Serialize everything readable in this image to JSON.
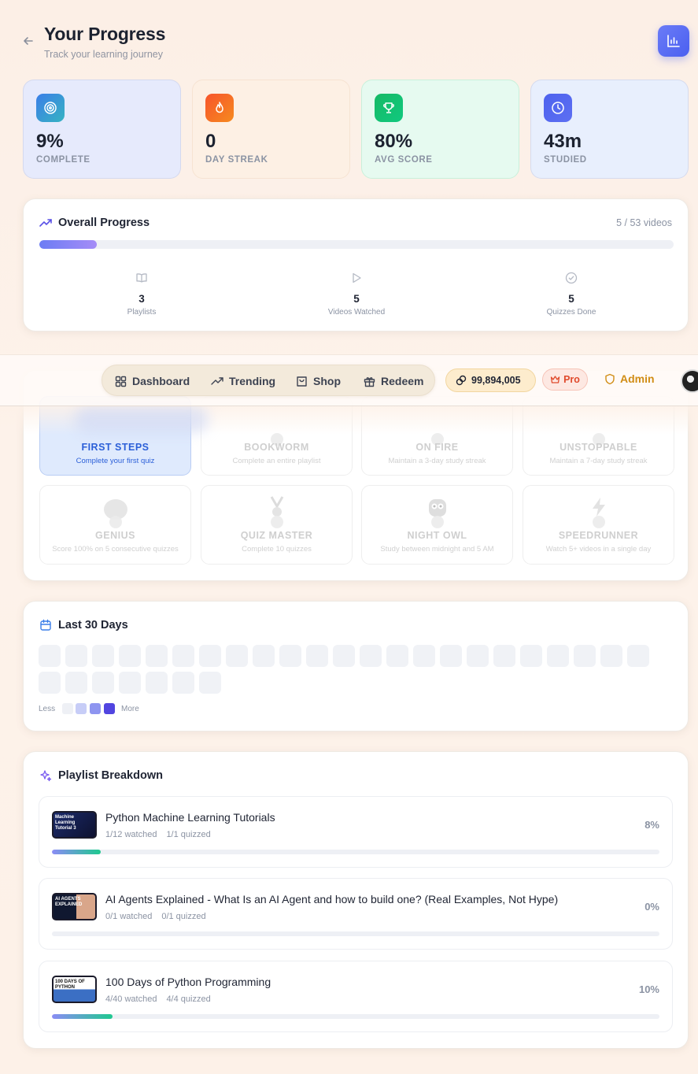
{
  "header": {
    "title": "Your Progress",
    "subtitle": "Track your learning journey"
  },
  "stats": [
    {
      "value": "9%",
      "label": "COMPLETE",
      "icon": "target-icon"
    },
    {
      "value": "0",
      "label": "DAY STREAK",
      "icon": "flame-icon"
    },
    {
      "value": "80%",
      "label": "AVG SCORE",
      "icon": "trophy-icon"
    },
    {
      "value": "43m",
      "label": "STUDIED",
      "icon": "clock-icon"
    }
  ],
  "overall": {
    "title": "Overall Progress",
    "count": "5 / 53 videos",
    "progress_fraction": 0.09,
    "items": [
      {
        "value": "3",
        "label": "Playlists"
      },
      {
        "value": "5",
        "label": "Videos Watched"
      },
      {
        "value": "5",
        "label": "Quizzes Done"
      }
    ]
  },
  "nav": {
    "dashboard": "Dashboard",
    "trending": "Trending",
    "shop": "Shop",
    "redeem": "Redeem",
    "coins": "99,894,005",
    "pro": "Pro",
    "admin": "Admin"
  },
  "achievements": [
    {
      "name": "FIRST STEPS",
      "desc": "Complete your first quiz",
      "unlocked": true
    },
    {
      "name": "BOOKWORM",
      "desc": "Complete an entire playlist",
      "unlocked": false
    },
    {
      "name": "ON FIRE",
      "desc": "Maintain a 3-day study streak",
      "unlocked": false
    },
    {
      "name": "UNSTOPPABLE",
      "desc": "Maintain a 7-day study streak",
      "unlocked": false
    },
    {
      "name": "GENIUS",
      "desc": "Score 100% on 5 consecutive quizzes",
      "unlocked": false
    },
    {
      "name": "QUIZ MASTER",
      "desc": "Complete 10 quizzes",
      "unlocked": false
    },
    {
      "name": "NIGHT OWL",
      "desc": "Study between midnight and 5 AM",
      "unlocked": false
    },
    {
      "name": "SPEEDRUNNER",
      "desc": "Watch 5+ videos in a single day",
      "unlocked": false
    }
  ],
  "last30": {
    "title": "Last 30 Days",
    "less": "Less",
    "more": "More",
    "legend_colors": [
      "#eef0f5",
      "#c7cdf7",
      "#8e95f0",
      "#5145e0"
    ]
  },
  "playlists": {
    "title": "Playlist Breakdown",
    "items": [
      {
        "title": "Python Machine Learning Tutorials",
        "watched": "1/12 watched",
        "quizzed": "1/1 quizzed",
        "pct": "8%",
        "fraction": 0.08
      },
      {
        "title": "AI Agents Explained - What Is an AI Agent and how to build one? (Real Examples, Not Hype)",
        "watched": "0/1 watched",
        "quizzed": "0/1 quizzed",
        "pct": "0%",
        "fraction": 0.0
      },
      {
        "title": "100 Days of Python Programming",
        "watched": "4/40 watched",
        "quizzed": "4/4 quizzed",
        "pct": "10%",
        "fraction": 0.1
      }
    ]
  }
}
